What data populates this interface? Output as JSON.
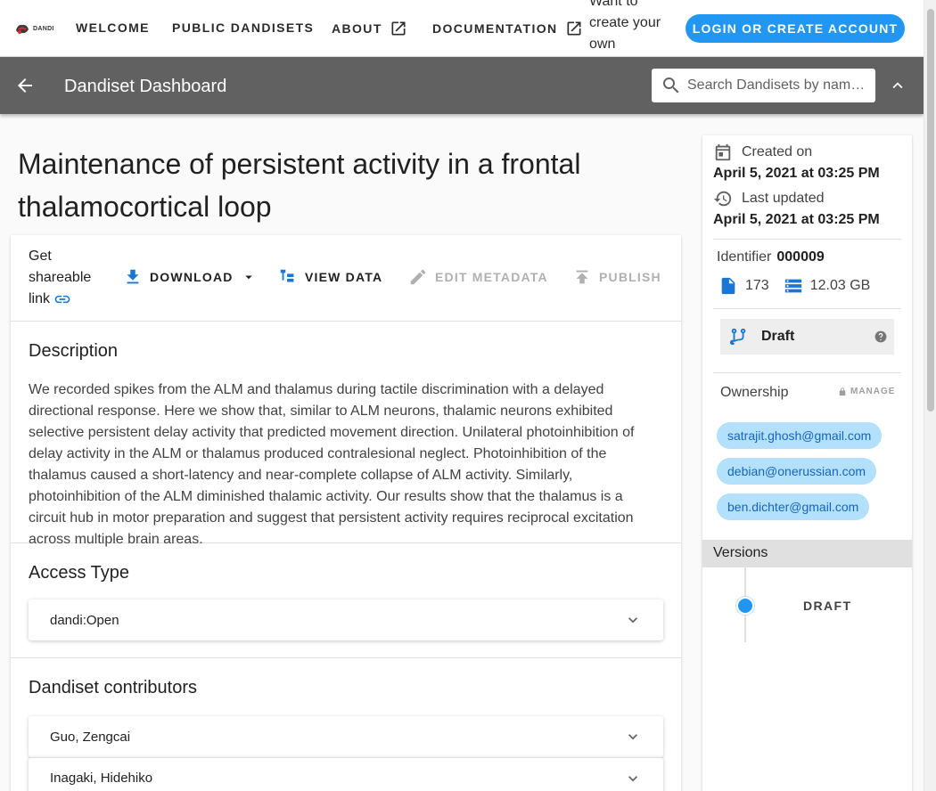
{
  "nav": {
    "logo_text": "DANDI",
    "welcome": "WELCOME",
    "public_dandisets": "PUBLIC DANDISETS",
    "about": "ABOUT",
    "documentation": "DOCUMENTATION",
    "create_prompt": "Want to create your own datasets?",
    "login": "LOGIN OR CREATE ACCOUNT"
  },
  "toolbar": {
    "title": "Dandiset Dashboard",
    "search_placeholder": "Search Dandisets by name, description, ID, or contributor name"
  },
  "dandiset": {
    "title": "Maintenance of persistent activity in a frontal thalamocortical loop",
    "actions": {
      "share": "Get shareable link",
      "download": "DOWNLOAD",
      "view_data": "VIEW DATA",
      "edit_metadata": "EDIT METADATA",
      "publish": "PUBLISH"
    },
    "description_heading": "Description",
    "description": "We recorded spikes from the ALM and thalamus during tactile discrimination with a delayed directional response. Here we show that, similar to ALM neurons, thalamic neurons exhibited selective persistent delay activity that predicted movement direction. Unilateral photoinhibition of delay activity in the ALM or thalamus produced contralesional neglect. Photoinhibition of the thalamus caused a short-latency and near-complete collapse of ALM activity. Similarly, photoinhibition of the ALM diminished thalamic activity. Our results show that the thalamus is a circuit hub in motor preparation and suggest that persistent activity requires reciprocal excitation across multiple brain areas.",
    "access_heading": "Access Type",
    "access_value": "dandi:Open",
    "contributors_heading": "Dandiset contributors",
    "contributors": [
      "Guo, Zengcai",
      "Inagaki, Hidehiko"
    ]
  },
  "sidebar": {
    "created_label": "Created on",
    "created_value": "April 5, 2021 at 03:25 PM",
    "updated_label": "Last updated",
    "updated_value": "April 5, 2021 at 03:25 PM",
    "identifier_label": "Identifier",
    "identifier_value": "000009",
    "file_count": "173",
    "size": "12.03 GB",
    "status": "Draft",
    "ownership_label": "Ownership",
    "manage_label": "MANAGE",
    "owners": [
      "satrajit.ghosh@gmail.com",
      "debian@onerussian.com",
      "ben.dichter@gmail.com"
    ],
    "versions_label": "Versions",
    "version": "DRAFT"
  },
  "colors": {
    "accent": "#2196f3",
    "toolbar": "#616161",
    "chip_bg": "#b3e0fb",
    "chip_text": "#1565c0"
  }
}
